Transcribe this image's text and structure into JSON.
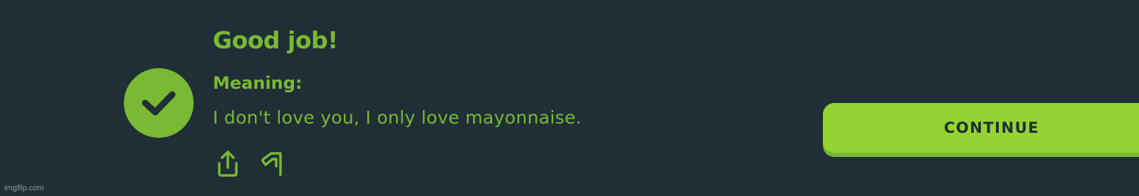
{
  "feedback": {
    "title": "Good job!",
    "meaning_label": "Meaning:",
    "meaning_text": "I don't love you, I only love mayonnaise.",
    "badge_icon": "checkmark-icon",
    "share_icon": "share-icon",
    "report_icon": "flag-icon"
  },
  "actions": {
    "continue_label": "CONTINUE"
  },
  "watermark": "imgflip.com",
  "colors": {
    "background": "#202f36",
    "accent_green": "#79b933",
    "button_green": "#93d333",
    "button_shadow": "#79b933",
    "button_text": "#1f2d33"
  }
}
